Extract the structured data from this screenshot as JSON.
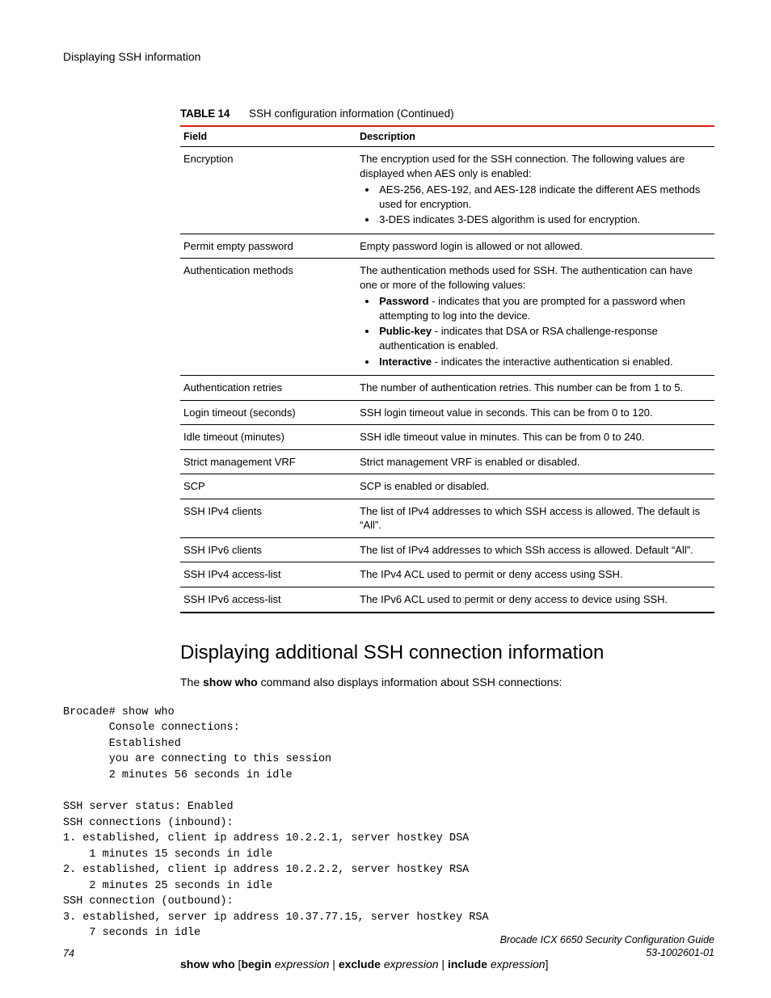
{
  "running_head": "Displaying SSH information",
  "table": {
    "number": "TABLE 14",
    "caption": "SSH configuration information (Continued)",
    "col_field": "Field",
    "col_desc": "Description",
    "rows": {
      "encryption": {
        "field": "Encryption",
        "desc_lead": "The encryption used for the SSH connection. The following values are displayed when AES only is enabled:",
        "b1": "AES-256, AES-192, and AES-128 indicate the different AES methods used for encryption.",
        "b2": "3-DES indicates 3-DES algorithm is used for encryption."
      },
      "permit_empty": {
        "field": "Permit empty password",
        "desc": "Empty password login is allowed or not allowed."
      },
      "auth_methods": {
        "field": "Authentication methods",
        "desc_lead": "The authentication methods used for SSH. The authentication can have one or more of the following values:",
        "b1_bold": "Password",
        "b1_rest": " - indicates that you are prompted for a password when attempting to log into the device.",
        "b2_bold": "Public-key",
        "b2_rest": " - indicates that DSA or RSA challenge-response authentication is enabled.",
        "b3_bold": "Interactive",
        "b3_rest": " - indicates the interactive authentication si enabled."
      },
      "auth_retries": {
        "field": "Authentication retries",
        "desc": "The number of authentication retries. This number can be from 1 to 5."
      },
      "login_timeout": {
        "field": "Login timeout (seconds)",
        "desc": "SSH login timeout value in seconds. This can be from 0 to 120."
      },
      "idle_timeout": {
        "field": "Idle timeout (minutes)",
        "desc": "SSH idle timeout value in minutes. This can be from 0 to 240."
      },
      "strict_vrf": {
        "field": "Strict management VRF",
        "desc": "Strict management VRF is enabled or disabled."
      },
      "scp": {
        "field": "SCP",
        "desc": "SCP is enabled or disabled."
      },
      "ipv4_clients": {
        "field": "SSH IPv4 clients",
        "desc": "The list of IPv4 addresses to which SSH access is allowed. The default is “All”."
      },
      "ipv6_clients": {
        "field": "SSH IPv6 clients",
        "desc": "The list of IPv4 addresses to which SSh access is allowed. Default “All”."
      },
      "ipv4_acl": {
        "field": "SSH IPv4 access-list",
        "desc": "The IPv4 ACL used to permit or deny access using SSH."
      },
      "ipv6_acl": {
        "field": "SSH IPv6 access-list",
        "desc": "The IPv6 ACL used to permit or deny access to device using SSH."
      }
    }
  },
  "section_heading": "Displaying additional SSH connection information",
  "body": {
    "pre": "The ",
    "cmd": "show who",
    "post": " command also displays information about SSH connections:"
  },
  "terminal": "Brocade# show who\n       Console connections:\n       Established\n       you are connecting to this session\n       2 minutes 56 seconds in idle\n\nSSH server status: Enabled\nSSH connections (inbound):\n1. established, client ip address 10.2.2.1, server hostkey DSA\n    1 minutes 15 seconds in idle\n2. established, client ip address 10.2.2.2, server hostkey RSA\n    2 minutes 25 seconds in idle\nSSH connection (outbound):\n3. established, server ip address 10.37.77.15, server hostkey RSA\n    7 seconds in idle",
  "syntax": {
    "cmd1": "show who",
    "br1": " [",
    "cmd2": "begin",
    "sp": " ",
    "arg": "expression",
    "pipe": " | ",
    "cmd3": "exclude",
    "cmd4": "include",
    "br2": "]"
  },
  "footer": {
    "page": "74",
    "title": "Brocade ICX 6650 Security Configuration Guide",
    "docnum": "53-1002601-01"
  }
}
